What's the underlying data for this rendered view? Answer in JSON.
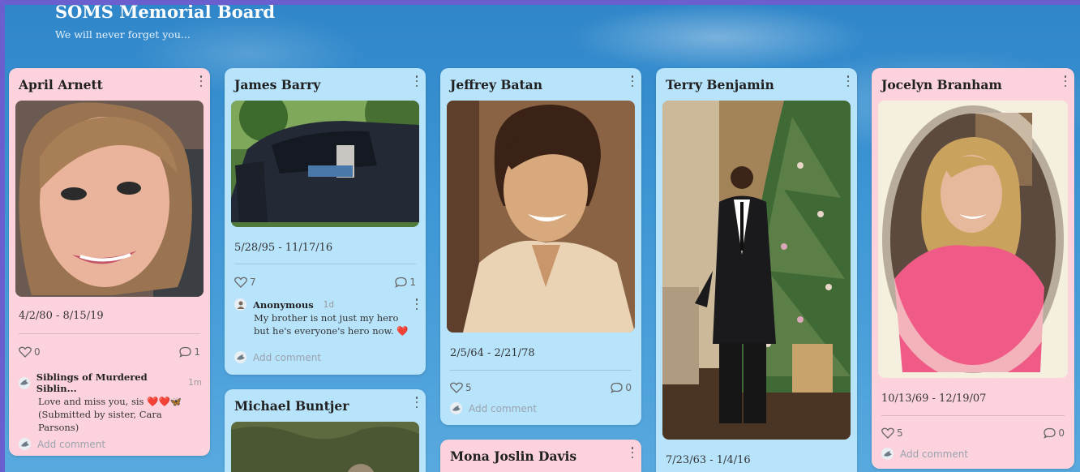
{
  "board": {
    "title": "SOMS Memorial Board",
    "subtitle": "We will never forget you..."
  },
  "colors": {
    "pink_card": "#fcd3dd",
    "blue_card": "#b7e3fb",
    "sky": "#3f97d6"
  },
  "add_comment_label": "Add comment",
  "cards": [
    {
      "name": "April Arnett",
      "dates": "4/2/80 - 8/15/19",
      "likes": "0",
      "comments": "1",
      "comment": {
        "author": "Siblings of Murdered Siblin...",
        "time": "1m",
        "body": "Love and miss you, sis",
        "emoji": "❤️❤️🦋",
        "body2": "(Submitted by sister, Cara Parsons)"
      }
    },
    {
      "name": "James Barry",
      "dates": "5/28/95 - 11/17/16",
      "likes": "7",
      "comments": "1",
      "comment": {
        "author": "Anonymous",
        "time": "1d",
        "body": "My brother is not just my hero but he's everyone's hero now.",
        "emoji": "❤️"
      }
    },
    {
      "name": "Michael Buntjer"
    },
    {
      "name": "Jeffrey Batan",
      "dates": "2/5/64 - 2/21/78",
      "likes": "5",
      "comments": "0"
    },
    {
      "name": "Mona Joslin Davis"
    },
    {
      "name": "Terry Benjamin",
      "dates": "7/23/63 - 1/4/16"
    },
    {
      "name": "Jocelyn Branham",
      "dates": "10/13/69 - 12/19/07",
      "likes": "5",
      "comments": "0"
    }
  ]
}
